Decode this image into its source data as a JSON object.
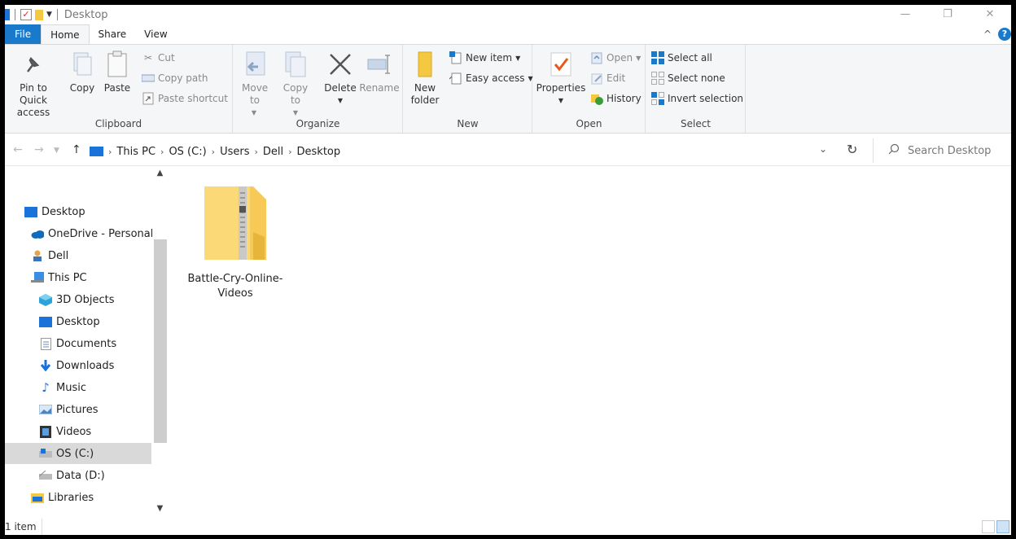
{
  "window": {
    "title": "Desktop"
  },
  "tabs": [
    {
      "label": "File"
    },
    {
      "label": "Home"
    },
    {
      "label": "Share"
    },
    {
      "label": "View"
    }
  ],
  "ribbon": {
    "clipboard": {
      "label": "Clipboard",
      "pin": "Pin to Quick access",
      "copy": "Copy",
      "paste": "Paste",
      "cut": "Cut",
      "copy_path": "Copy path",
      "paste_shortcut": "Paste shortcut"
    },
    "organize": {
      "label": "Organize",
      "move_to": "Move to",
      "copy_to": "Copy to",
      "delete": "Delete",
      "rename": "Rename"
    },
    "new": {
      "label": "New",
      "new_folder": "New folder",
      "new_item": "New item",
      "easy_access": "Easy access"
    },
    "open": {
      "label": "Open",
      "properties": "Properties",
      "open": "Open",
      "edit": "Edit",
      "history": "History"
    },
    "select": {
      "label": "Select",
      "select_all": "Select all",
      "select_none": "Select none",
      "invert_selection": "Invert selection"
    }
  },
  "address": {
    "crumbs": [
      "This PC",
      "OS (C:)",
      "Users",
      "Dell",
      "Desktop"
    ],
    "search_placeholder": "Search Desktop"
  },
  "nav": {
    "items": [
      {
        "label": "Desktop",
        "icon": "desktop-icon"
      },
      {
        "label": "OneDrive - Personal",
        "icon": "cloud-icon"
      },
      {
        "label": "Dell",
        "icon": "user-icon"
      },
      {
        "label": "This PC",
        "icon": "computer-icon"
      },
      {
        "label": "3D Objects",
        "icon": "cube-icon"
      },
      {
        "label": "Desktop",
        "icon": "desktop-icon"
      },
      {
        "label": "Documents",
        "icon": "document-icon"
      },
      {
        "label": "Downloads",
        "icon": "download-icon"
      },
      {
        "label": "Music",
        "icon": "music-icon"
      },
      {
        "label": "Pictures",
        "icon": "picture-icon"
      },
      {
        "label": "Videos",
        "icon": "video-icon"
      },
      {
        "label": "OS (C:)",
        "icon": "drive-icon"
      },
      {
        "label": "Data (D:)",
        "icon": "drive-icon"
      },
      {
        "label": "Libraries",
        "icon": "library-icon"
      }
    ]
  },
  "content": {
    "files": [
      {
        "name": "Battle-Cry-Online-Videos",
        "type": "zip-folder"
      }
    ]
  },
  "status": {
    "count": "1 item"
  },
  "colors": {
    "accent": "#1979ca",
    "folder": "#f5c842"
  }
}
